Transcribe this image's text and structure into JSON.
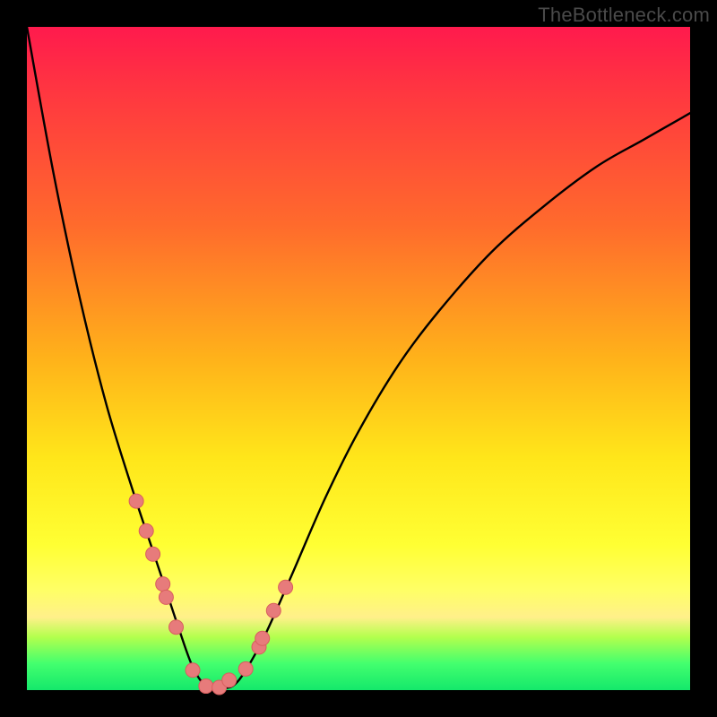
{
  "watermark": "TheBottleneck.com",
  "colors": {
    "frame": "#000000",
    "curve": "#000000",
    "marker_fill": "#e77b7b",
    "marker_stroke": "#d85e5e",
    "gradient_stops": [
      {
        "pct": 0,
        "hex": "#ff1a4d"
      },
      {
        "pct": 10,
        "hex": "#ff3740"
      },
      {
        "pct": 30,
        "hex": "#ff6b2c"
      },
      {
        "pct": 50,
        "hex": "#ffb21a"
      },
      {
        "pct": 65,
        "hex": "#ffe61a"
      },
      {
        "pct": 78,
        "hex": "#ffff33"
      },
      {
        "pct": 85,
        "hex": "#ffff66"
      },
      {
        "pct": 89,
        "hex": "#fff08a"
      },
      {
        "pct": 92,
        "hex": "#b3ff4d"
      },
      {
        "pct": 96,
        "hex": "#43ff6e"
      },
      {
        "pct": 100,
        "hex": "#14e86b"
      }
    ]
  },
  "chart_data": {
    "type": "line",
    "title": "",
    "xlabel": "",
    "ylabel": "",
    "xlim": [
      0,
      1
    ],
    "ylim": [
      0,
      1
    ],
    "note": "V-shaped bottleneck curve. x is a normalized component-match axis (no ticks/labels shown); y is bottleneck fraction from 0 (none, green) to 1 (severe, red). Minimum near x≈0.275. Values are estimated from pixel positions.",
    "x": [
      0.0,
      0.04,
      0.08,
      0.12,
      0.16,
      0.19,
      0.21,
      0.23,
      0.25,
      0.27,
      0.29,
      0.31,
      0.33,
      0.36,
      0.4,
      0.45,
      0.5,
      0.56,
      0.62,
      0.7,
      0.78,
      0.86,
      0.93,
      1.0
    ],
    "y": [
      1.0,
      0.78,
      0.59,
      0.43,
      0.3,
      0.21,
      0.15,
      0.09,
      0.035,
      0.006,
      0.004,
      0.006,
      0.03,
      0.085,
      0.175,
      0.29,
      0.39,
      0.49,
      0.57,
      0.66,
      0.73,
      0.79,
      0.83,
      0.87
    ],
    "markers": {
      "x": [
        0.165,
        0.18,
        0.19,
        0.205,
        0.21,
        0.225,
        0.25,
        0.27,
        0.29,
        0.305,
        0.33,
        0.35,
        0.355,
        0.372,
        0.39
      ],
      "y": [
        0.285,
        0.24,
        0.205,
        0.16,
        0.14,
        0.095,
        0.03,
        0.006,
        0.004,
        0.015,
        0.032,
        0.065,
        0.078,
        0.12,
        0.155
      ]
    }
  }
}
